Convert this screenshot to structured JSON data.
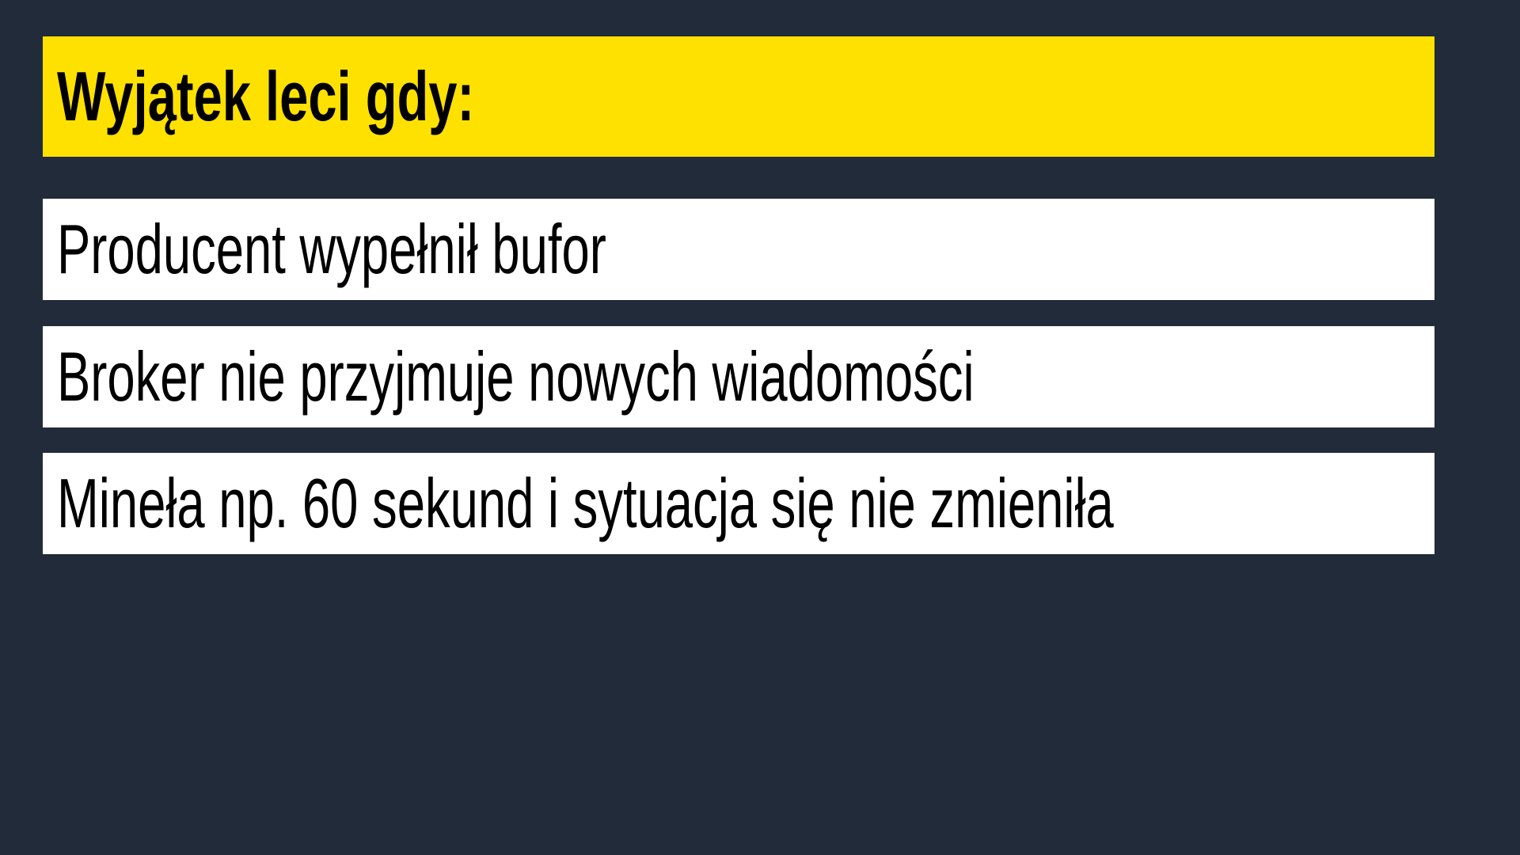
{
  "slide": {
    "title": "Wyjątek leci gdy:",
    "items": [
      "Producent wypełnił bufor",
      "Broker nie przyjmuje nowych wiadomości",
      "Mineła np. 60 sekund i sytuacja się nie zmieniła"
    ]
  },
  "colors": {
    "background": "#212b3a",
    "title_background": "#ffe100",
    "item_background": "#ffffff",
    "text": "#000000"
  }
}
